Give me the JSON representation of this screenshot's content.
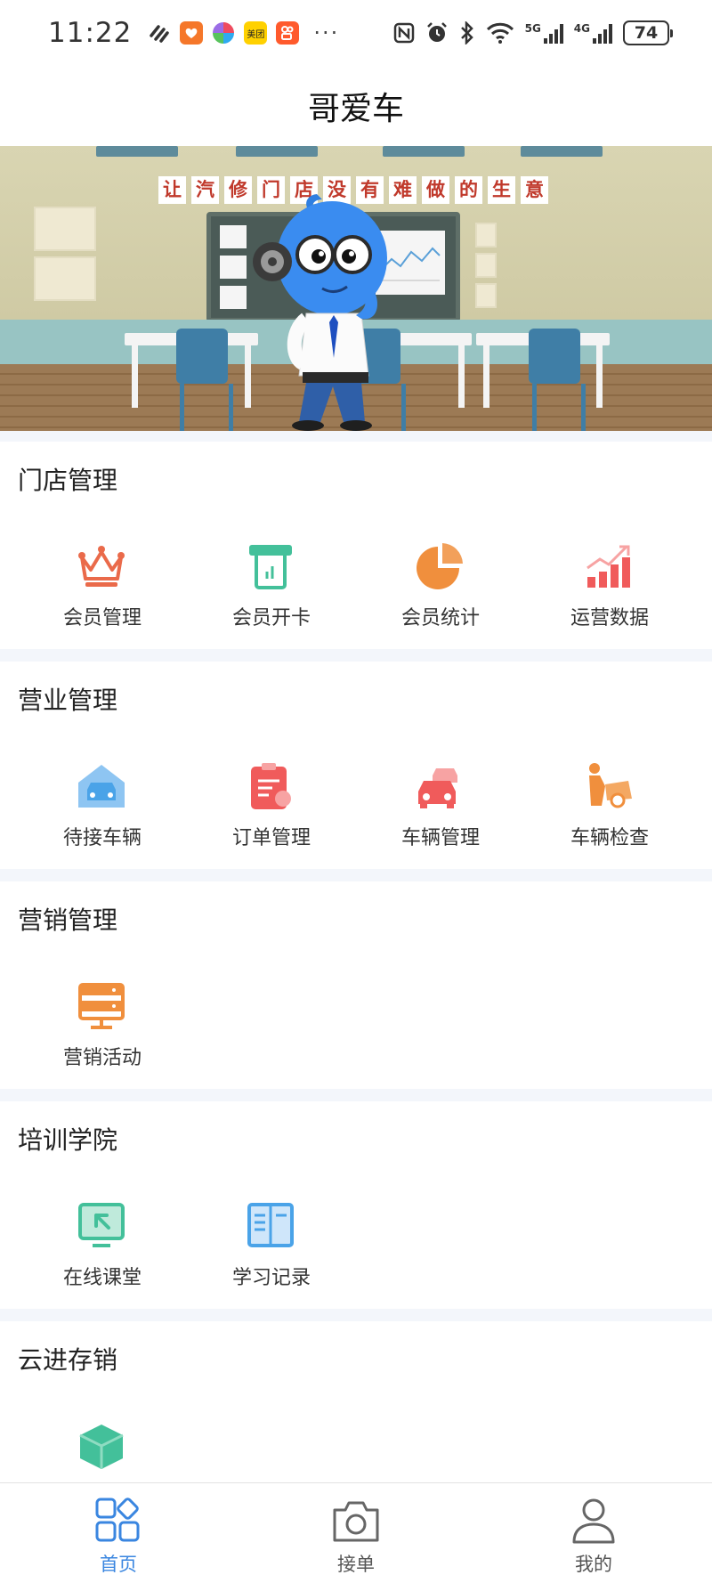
{
  "status_bar": {
    "time": "11:22",
    "left_icons": [
      "link-app-icon",
      "taobao-app-icon",
      "pinwheel-app-icon",
      "meituan-app-icon",
      "kuaishou-app-icon"
    ],
    "meituan_label": "美团",
    "overflow": "···",
    "network_1": "5G",
    "network_2": "4G",
    "battery": "74"
  },
  "header": {
    "title": "哥爱车"
  },
  "banner": {
    "slogan": [
      "让",
      "汽",
      "修",
      "门",
      "店",
      "没",
      "有",
      "难",
      "做",
      "的",
      "生",
      "意"
    ]
  },
  "sections": [
    {
      "title": "门店管理",
      "items": [
        {
          "label": "会员管理",
          "icon": "crown-icon",
          "color": "#ea6a4a"
        },
        {
          "label": "会员开卡",
          "icon": "card-machine-icon",
          "color": "#43c09a"
        },
        {
          "label": "会员统计",
          "icon": "pie-chart-icon",
          "color": "#f08f3d"
        },
        {
          "label": "运营数据",
          "icon": "rising-bars-icon",
          "color": "#f05b5b"
        }
      ]
    },
    {
      "title": "营业管理",
      "items": [
        {
          "label": "待接车辆",
          "icon": "garage-car-icon",
          "color": "#4aa3e8"
        },
        {
          "label": "订单管理",
          "icon": "clipboard-icon",
          "color": "#f05b5b"
        },
        {
          "label": "车辆管理",
          "icon": "cars-icon",
          "color": "#f05b5b"
        },
        {
          "label": "车辆检查",
          "icon": "mechanic-icon",
          "color": "#f08f3d"
        }
      ]
    },
    {
      "title": "营销管理",
      "items": [
        {
          "label": "营销活动",
          "icon": "monitor-panel-icon",
          "color": "#f08f3d"
        }
      ]
    },
    {
      "title": "培训学院",
      "items": [
        {
          "label": "在线课堂",
          "icon": "online-class-icon",
          "color": "#43c09a"
        },
        {
          "label": "学习记录",
          "icon": "study-record-icon",
          "color": "#4aa3e8"
        }
      ]
    },
    {
      "title": "云进存销",
      "items": [
        {
          "label": "",
          "icon": "box-icon",
          "color": "#43c09a"
        }
      ]
    }
  ],
  "tabbar": {
    "tabs": [
      {
        "label": "首页",
        "icon": "home-grid-icon",
        "active": true
      },
      {
        "label": "接单",
        "icon": "camera-icon",
        "active": false
      },
      {
        "label": "我的",
        "icon": "user-icon",
        "active": false
      }
    ],
    "active_color": "#3a86e0"
  }
}
